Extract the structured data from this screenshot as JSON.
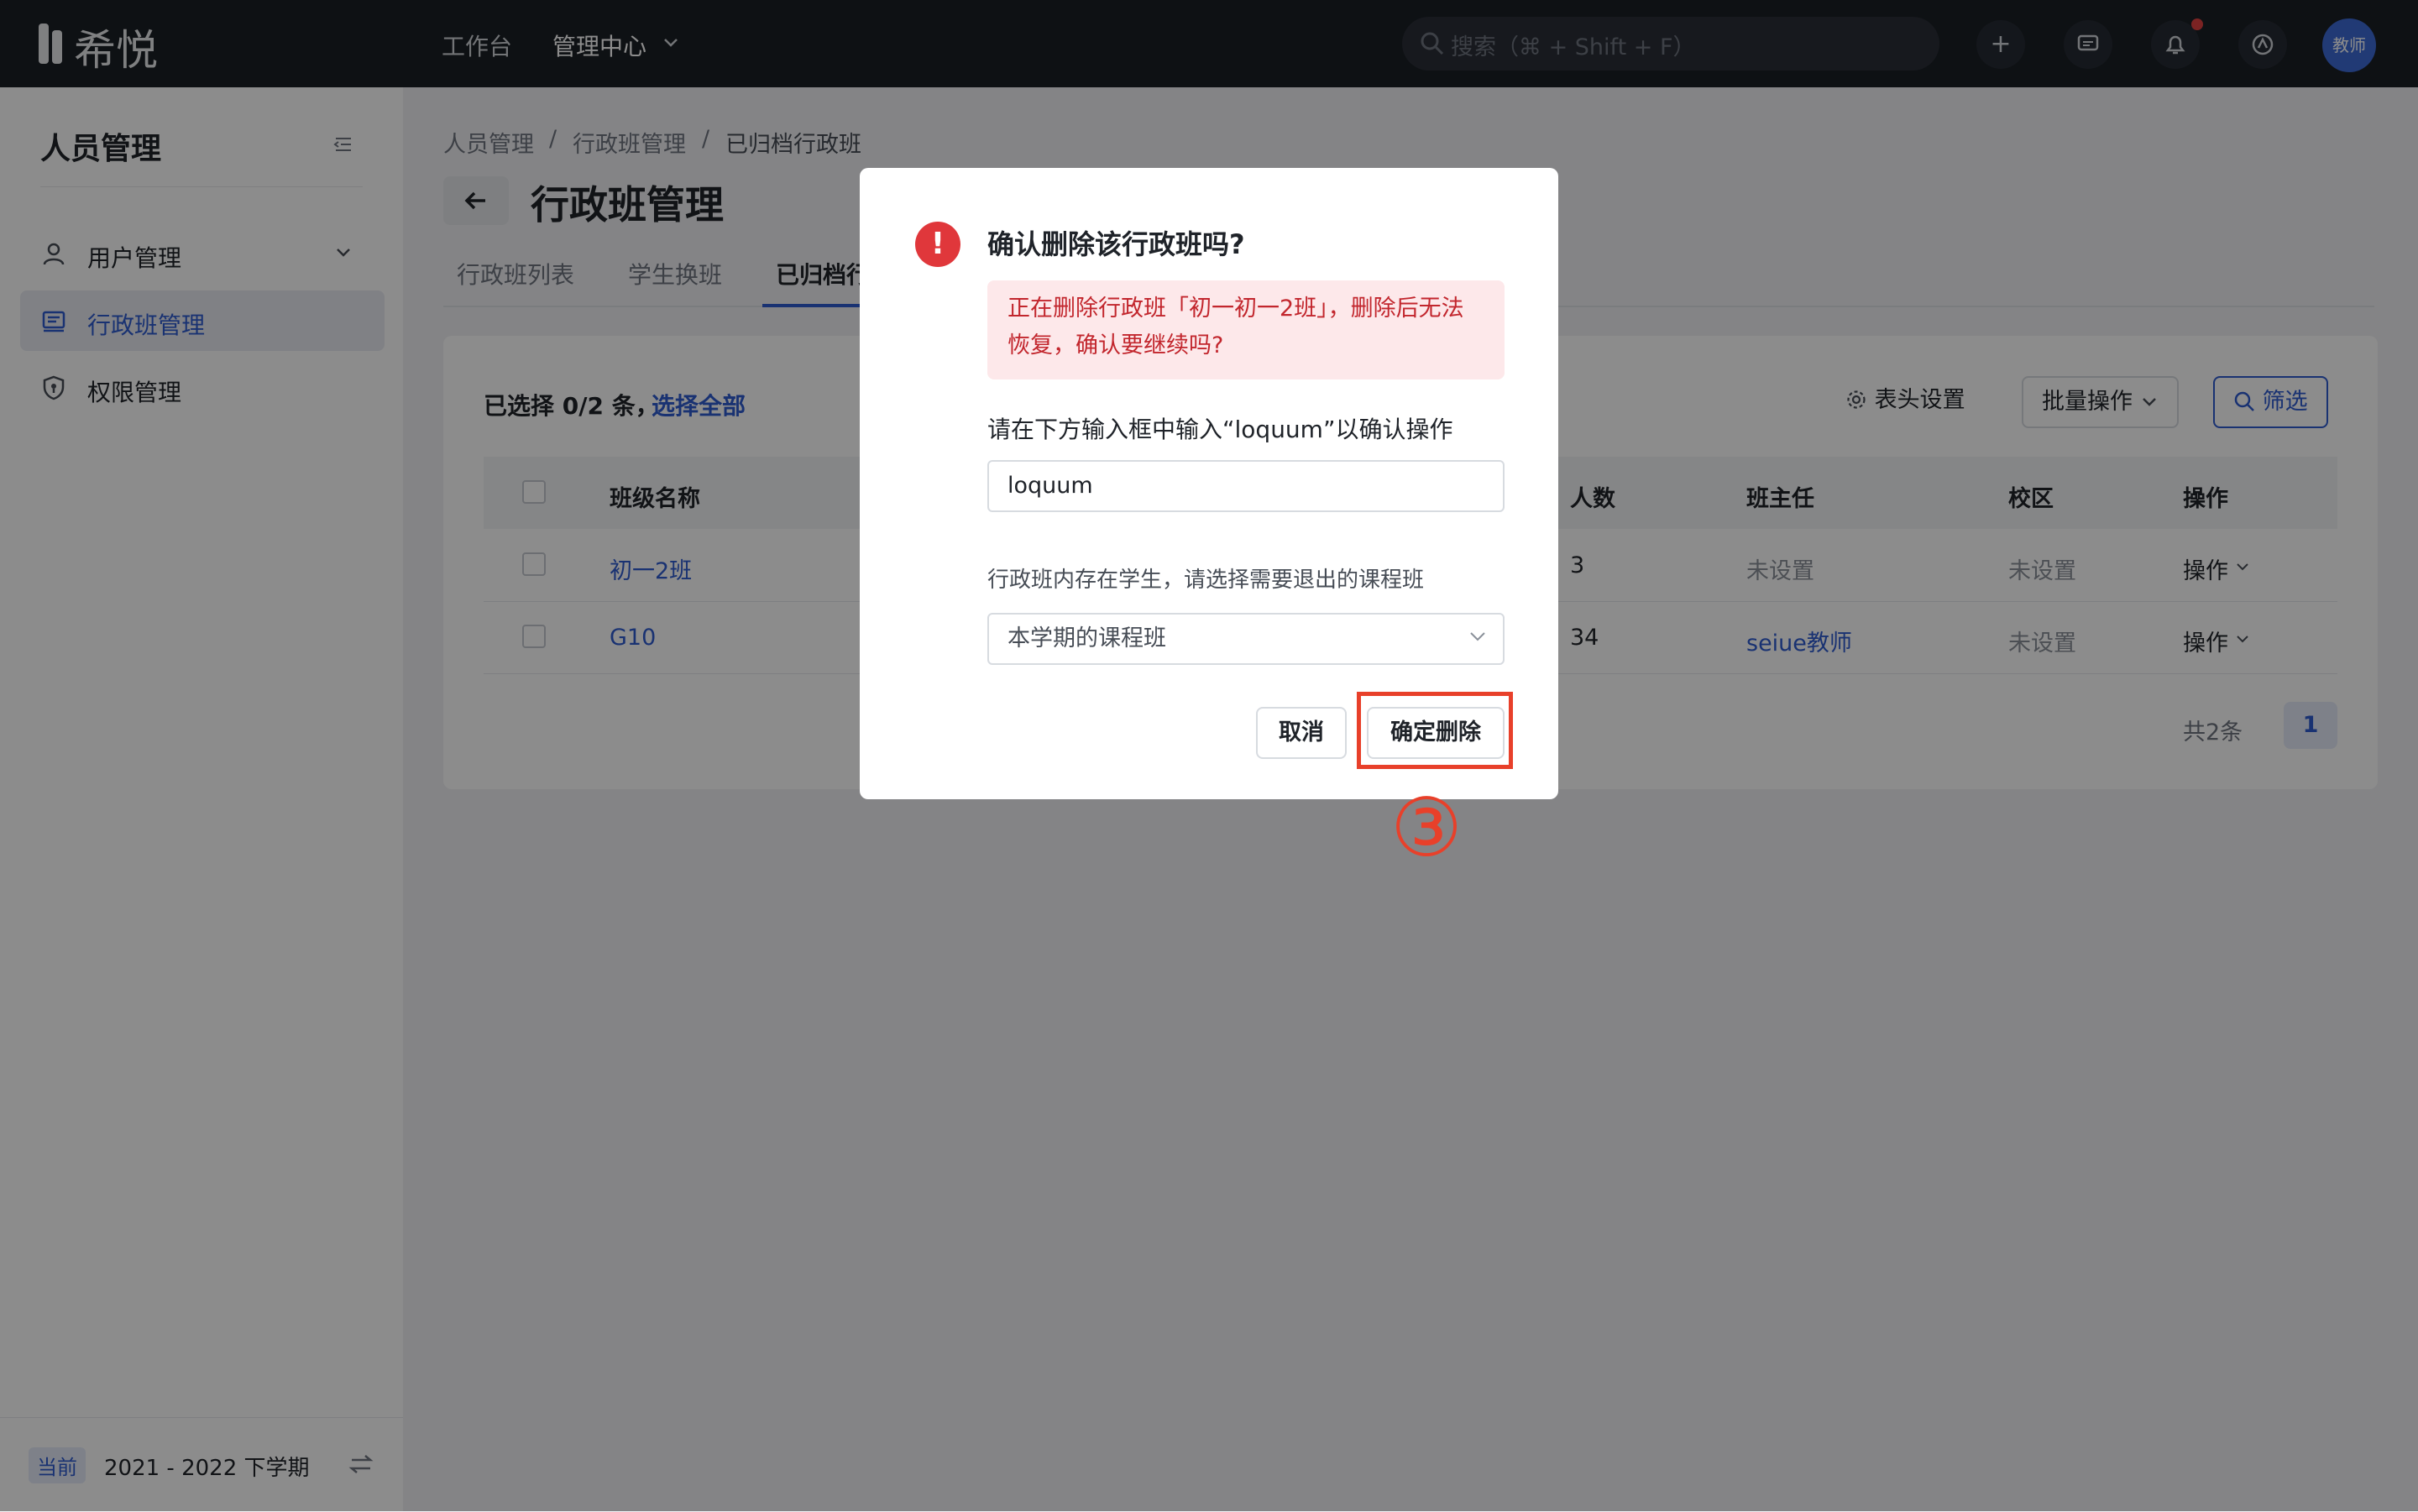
{
  "topbar": {
    "logo_text": "希悦",
    "nav": [
      "工作台",
      "管理中心"
    ],
    "search_placeholder": "搜索（⌘ + Shift + F）",
    "avatar_text": "教师"
  },
  "sidebar": {
    "title": "人员管理",
    "items": [
      {
        "label": "用户管理",
        "icon": "user-icon"
      },
      {
        "label": "行政班管理",
        "icon": "class-icon"
      },
      {
        "label": "权限管理",
        "icon": "shield-icon"
      }
    ],
    "footer": {
      "badge": "当前",
      "term": "2021 - 2022 下学期"
    }
  },
  "main": {
    "breadcrumb": [
      "人员管理",
      "行政班管理",
      "已归档行政班"
    ],
    "breadcrumb_sep": "/",
    "title": "行政班管理",
    "tabs": [
      "行政班列表",
      "学生换班",
      "已归档行"
    ],
    "selection_text": "已选择 0/2 条，",
    "select_all": "选择全部",
    "toolbar": {
      "column_settings": "表头设置",
      "batch": "批量操作",
      "filter": "筛选"
    },
    "table": {
      "headers": [
        "班级名称",
        "人数",
        "班主任",
        "校区",
        "操作"
      ],
      "rows": [
        {
          "name": "初一2班",
          "count": "3",
          "teacher": "未设置",
          "campus": "未设置",
          "action": "操作"
        },
        {
          "name": "G10",
          "count": "34",
          "teacher": "seiue教师",
          "campus": "未设置",
          "action": "操作"
        }
      ]
    },
    "pager": {
      "total": "共2条",
      "page": "1"
    }
  },
  "modal": {
    "title": "确认删除该行政班吗?",
    "alert": "正在删除行政班「初一初一2班」，删除后无法恢复，确认要继续吗?",
    "input_label": "请在下方输入框中输入“loquum”以确认操作",
    "input_value": "loquum",
    "select_label": "行政班内存在学生，请选择需要退出的课程班",
    "select_value": "本学期的课程班",
    "cancel": "取消",
    "confirm": "确定删除",
    "step": "③"
  },
  "colors": {
    "accent": "#2f5bd0",
    "danger": "#e0373b",
    "highlight": "#e8402a"
  }
}
